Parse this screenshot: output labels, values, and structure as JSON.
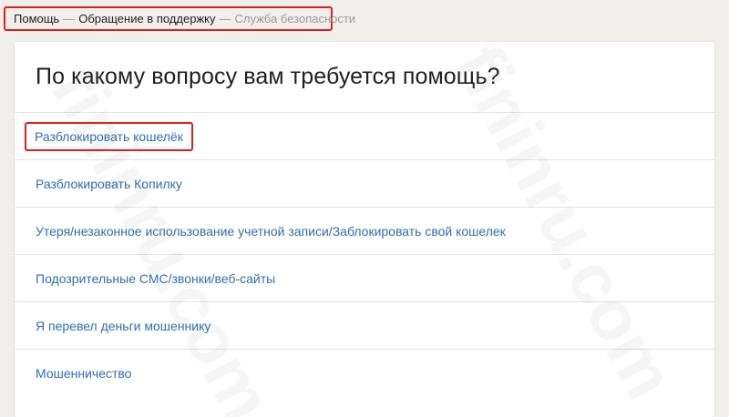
{
  "breadcrumb": {
    "items": [
      "Помощь",
      "Обращение в поддержку"
    ],
    "separator": "—",
    "current": "Служба безопасности"
  },
  "main": {
    "title": "По какому вопросу вам требуется помощь?",
    "options": [
      "Разблокировать кошелёк",
      "Разблокировать Копилку",
      "Утеря/незаконное использование учетной записи/Заблокировать свой кошелек",
      "Подозрительные СМС/звонки/веб-сайты",
      "Я перевел деньги мошеннику",
      "Мошенничество"
    ]
  },
  "watermark": "fininru.com",
  "colors": {
    "link": "#2f6db5",
    "highlight": "#e01e1e",
    "background": "#f0efeb",
    "card": "#ffffff"
  }
}
